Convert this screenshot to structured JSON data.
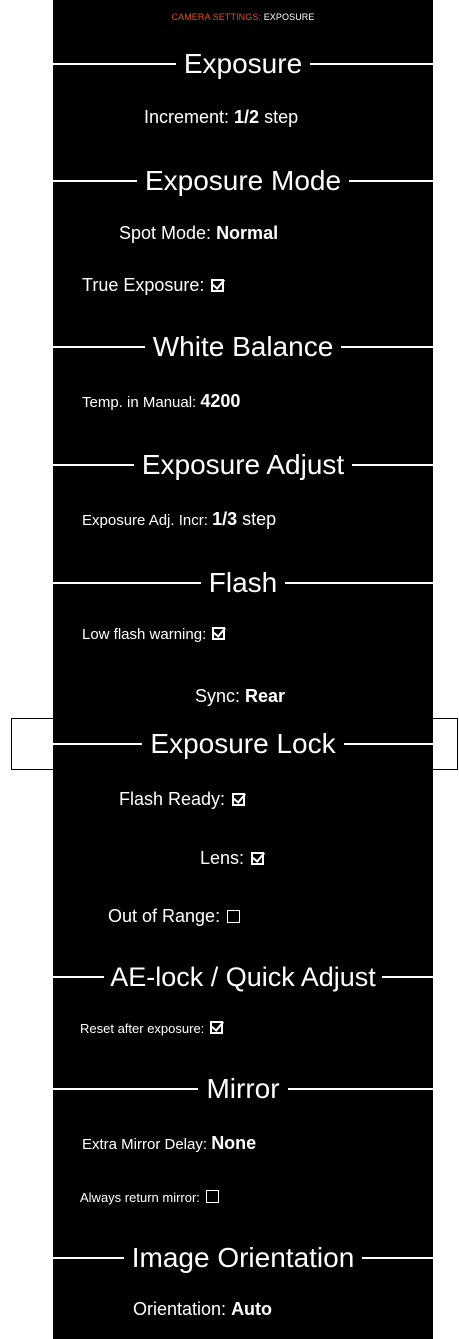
{
  "header": {
    "prefix": "CAMERA SETTINGS:",
    "suffix": " EXPOSURE",
    "prefix_color": "#e5501c"
  },
  "sections": {
    "exposure": {
      "title": "Exposure",
      "increment_label": "Increment: ",
      "increment_value": "1/2",
      "increment_unit": " step"
    },
    "exposure_mode": {
      "title": "Exposure Mode",
      "spot_label": "Spot Mode: ",
      "spot_value": "Normal",
      "true_exposure_label": "True Exposure:",
      "true_exposure_checked": true
    },
    "white_balance": {
      "title": "White Balance",
      "temp_label": "Temp. in Manual: ",
      "temp_value": "4200"
    },
    "exposure_adjust": {
      "title": "Exposure Adjust",
      "incr_label": "Exposure Adj. Incr: ",
      "incr_value": "1/3",
      "incr_unit": " step"
    },
    "flash": {
      "title": "Flash",
      "low_flash_label": "Low flash warning:",
      "low_flash_checked": true,
      "sync_label": "Sync: ",
      "sync_value": "Rear"
    },
    "exposure_lock": {
      "title": "Exposure Lock",
      "flash_ready_label": "Flash Ready:",
      "flash_ready_checked": true,
      "lens_label": "Lens:",
      "lens_checked": true,
      "out_of_range_label": "Out of Range:",
      "out_of_range_checked": false
    },
    "ae_lock": {
      "title": "AE-lock / Quick Adjust",
      "reset_label": "Reset after exposure:",
      "reset_checked": true
    },
    "mirror": {
      "title": "Mirror",
      "delay_label": "Extra Mirror Delay: ",
      "delay_value": "None",
      "always_return_label": "Always return mirror:",
      "always_return_checked": false
    },
    "image_orientation": {
      "title": "Image Orientation",
      "orientation_label": "Orientation: ",
      "orientation_value": "Auto"
    }
  },
  "colors": {
    "background": "#000000",
    "text": "#ffffff",
    "accent": "#e5501c"
  }
}
